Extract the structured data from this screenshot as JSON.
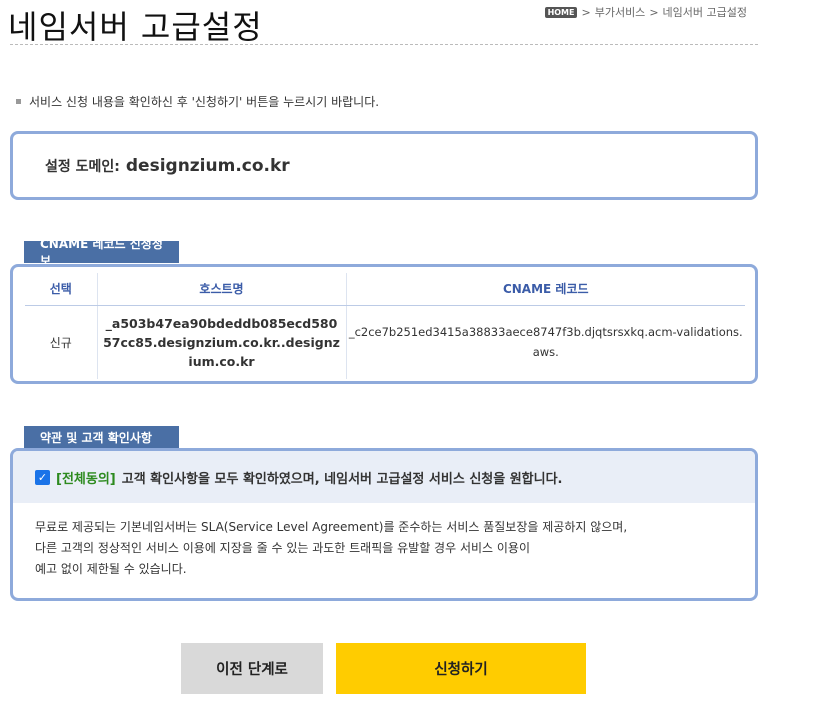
{
  "page": {
    "title": "네임서버 고급설정",
    "breadcrumb": {
      "home": "HOME",
      "sep": ">",
      "items": [
        "부가서비스",
        "네임서버 고급설정"
      ]
    },
    "notice": "서비스 신청 내용을 확인하신 후 '신청하기' 버튼을 누르시기 바랍니다."
  },
  "domain": {
    "label": "설정 도메인:",
    "value": "designzium.co.kr"
  },
  "cname": {
    "section_title": "CNAME 레코드 신청정보",
    "headers": [
      "선택",
      "호스트명",
      "CNAME 레코드"
    ],
    "row": {
      "type": "신규",
      "host": "_a503b47ea90bdeddb085ecd58057cc85.designzium.co.kr..designzium.co.kr",
      "record": "_c2ce7b251ed3415a38833aece8747f3b.djqtsrsxkq.acm-validations.aws."
    }
  },
  "terms": {
    "section_title": "약관 및 고객 확인사항",
    "agree_tag": "[전체동의]",
    "agree_text": "고객 확인사항을 모두 확인하였으며, 네임서버 고급설정 서비스 신청을 원합니다.",
    "agree_checked": true,
    "body_lines": [
      "무료로 제공되는 기본네임서버는 SLA(Service Level Agreement)를 준수하는 서비스 품질보장을 제공하지 않으며,",
      "다른 고객의 정상적인 서비스 이용에 지장을 줄 수 있는 과도한 트래픽을 유발할 경우 서비스 이용이",
      "예고 없이 제한될 수 있습니다."
    ]
  },
  "buttons": {
    "prev": "이전 단계로",
    "submit": "신청하기"
  },
  "colors": {
    "accent_blue": "#4a6fa5",
    "panel_border": "#8eaadb",
    "submit_yellow": "#ffcc00",
    "agree_green": "#2c8a1e"
  }
}
